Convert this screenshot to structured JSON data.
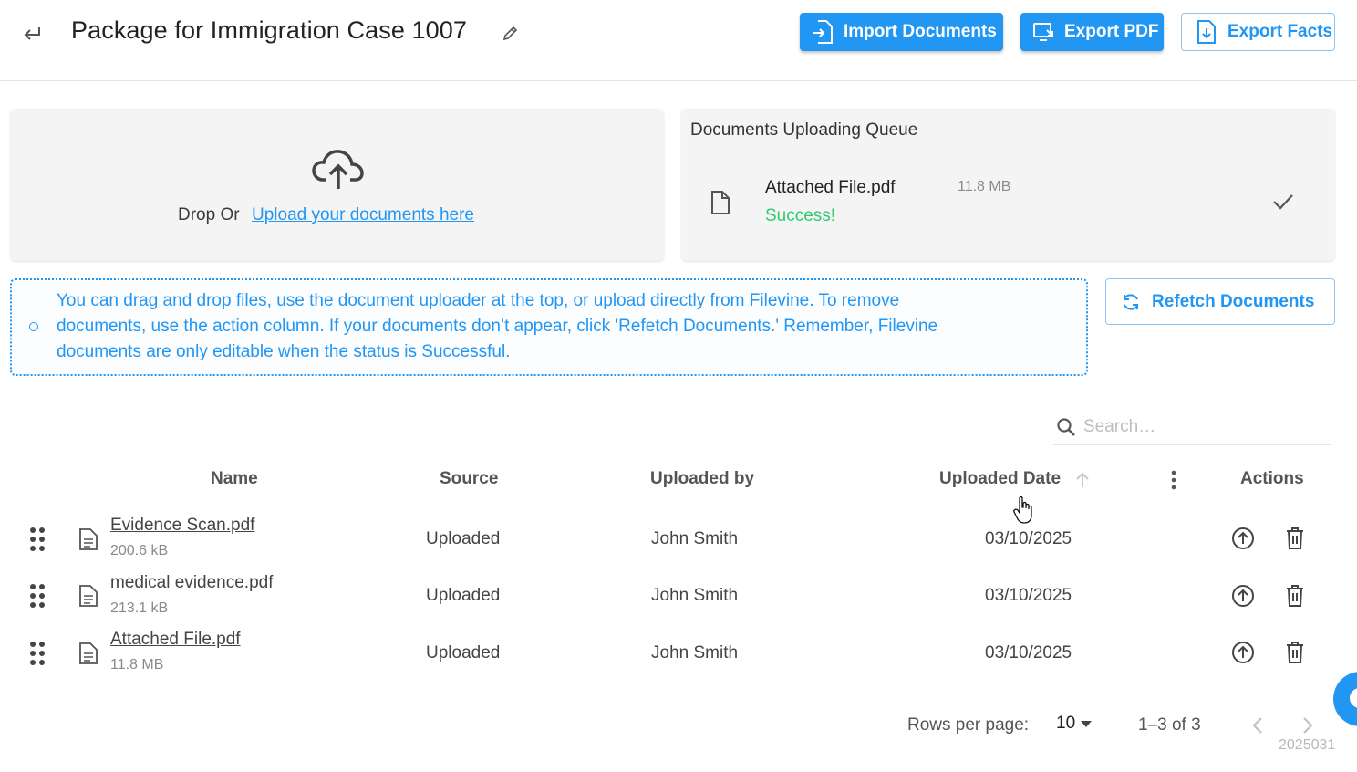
{
  "header": {
    "title": "Package for Immigration Case 1007",
    "buttons": {
      "import": "Import Documents",
      "export_pdf": "Export PDF",
      "export_facts": "Export Facts"
    }
  },
  "upload": {
    "drop_prefix": "Drop Or",
    "upload_link": "Upload your documents here"
  },
  "queue": {
    "title": "Documents Uploading Queue",
    "items": [
      {
        "name": "Attached File.pdf",
        "size": "11.8 MB",
        "status": "Success!"
      }
    ]
  },
  "info": {
    "lines": [
      "You can drag and drop files, use the document uploader at the top, or upload directly from Filevine. To remove",
      "documents, use the action column. If your documents don’t appear, click 'Refetch Documents.' Remember, Filevine",
      "documents are only editable when the status is Successful."
    ],
    "refetch_label": "Refetch Documents"
  },
  "search": {
    "placeholder": "Search…",
    "value": ""
  },
  "table": {
    "headers": {
      "name": "Name",
      "source": "Source",
      "uploaded_by": "Uploaded by",
      "uploaded_date": "Uploaded Date",
      "actions": "Actions"
    },
    "rows": [
      {
        "name": "Evidence Scan.pdf",
        "size": "200.6 kB",
        "source": "Uploaded",
        "uploaded_by": "John Smith",
        "date": "03/10/2025"
      },
      {
        "name": "medical evidence.pdf",
        "size": "213.1 kB",
        "source": "Uploaded",
        "uploaded_by": "John Smith",
        "date": "03/10/2025"
      },
      {
        "name": "Attached File.pdf",
        "size": "11.8 MB",
        "source": "Uploaded",
        "uploaded_by": "John Smith",
        "date": "03/10/2025"
      }
    ]
  },
  "pagination": {
    "rows_per_page_label": "Rows per page:",
    "rows_per_page": "10",
    "range": "1–3 of 3"
  },
  "build": "2025031",
  "colors": {
    "accent": "#2196f3",
    "success": "#2ecc71"
  },
  "icons": [
    "back-arrow-icon",
    "pencil-icon",
    "import-file-icon",
    "export-pdf-icon",
    "export-facts-icon",
    "cloud-upload-icon",
    "file-icon",
    "check-icon",
    "info-icon",
    "refresh-icon",
    "search-icon",
    "sort-arrow-up-icon",
    "kebab-icon",
    "drag-handle-icon",
    "document-icon",
    "upload-circle-icon",
    "trash-icon",
    "chevron-left-icon",
    "chevron-right-icon"
  ]
}
